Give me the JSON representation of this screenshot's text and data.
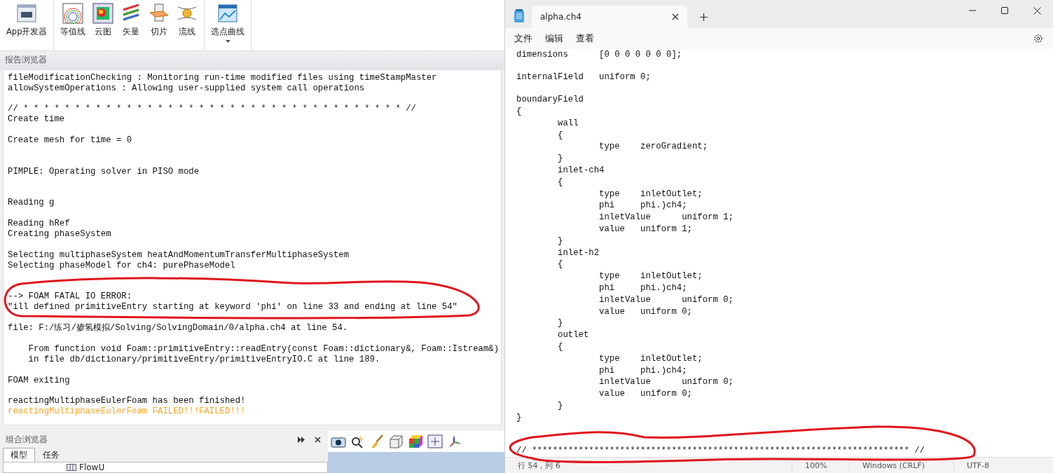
{
  "ribbon": {
    "groups": [
      {
        "buttons": [
          {
            "label": "App开发器",
            "kind": "app"
          }
        ]
      },
      {
        "buttons": [
          {
            "label": "等值线",
            "kind": "contour"
          },
          {
            "label": "云图",
            "kind": "cloud"
          },
          {
            "label": "矢量",
            "kind": "vector"
          },
          {
            "label": "切片",
            "kind": "slice"
          },
          {
            "label": "流线",
            "kind": "stream"
          }
        ]
      },
      {
        "buttons": [
          {
            "label": "选点曲线",
            "kind": "curve",
            "dropdown": true
          }
        ]
      }
    ]
  },
  "report_browser": {
    "title": "报告浏览器",
    "lines": [
      {
        "kind": "normal",
        "text": "fileModificationChecking : Monitoring run-time modified files using timeStampMaster"
      },
      {
        "kind": "normal",
        "text": "allowSystemOperations : Allowing user-supplied system call operations"
      },
      {
        "kind": "blank"
      },
      {
        "kind": "normal",
        "text": "// * * * * * * * * * * * * * * * * * * * * * * * * * * * * * * * * * * * * * //"
      },
      {
        "kind": "normal",
        "text": "Create time"
      },
      {
        "kind": "blank"
      },
      {
        "kind": "normal",
        "text": "Create mesh for time = 0"
      },
      {
        "kind": "blank"
      },
      {
        "kind": "blank"
      },
      {
        "kind": "normal",
        "text": "PIMPLE: Operating solver in PISO mode"
      },
      {
        "kind": "blank"
      },
      {
        "kind": "blank"
      },
      {
        "kind": "normal",
        "text": "Reading g"
      },
      {
        "kind": "blank"
      },
      {
        "kind": "normal",
        "text": "Reading hRef"
      },
      {
        "kind": "normal",
        "text": "Creating phaseSystem"
      },
      {
        "kind": "blank"
      },
      {
        "kind": "normal",
        "text": "Selecting multiphaseSystem heatAndMomentumTransferMultiphaseSystem"
      },
      {
        "kind": "normal",
        "text": "Selecting phaseModel for ch4: purePhaseModel"
      },
      {
        "kind": "blank"
      },
      {
        "kind": "blank"
      },
      {
        "kind": "normal",
        "text": "--> FOAM FATAL IO ERROR:"
      },
      {
        "kind": "normal",
        "text": "\"ill defined primitiveEntry starting at keyword 'phi' on line 33 and ending at line 54\""
      },
      {
        "kind": "blank"
      },
      {
        "kind": "normal",
        "text": "file: F:/练习/掺氢模拟/Solving/SolvingDomain/0/alpha.ch4 at line 54."
      },
      {
        "kind": "blank"
      },
      {
        "kind": "normal",
        "text": "    From function void Foam::primitiveEntry::readEntry(const Foam::dictionary&, Foam::Istream&)"
      },
      {
        "kind": "normal",
        "text": "    in file db/dictionary/primitiveEntry/primitiveEntryIO.C at line 189."
      },
      {
        "kind": "blank"
      },
      {
        "kind": "normal",
        "text": "FOAM exiting"
      },
      {
        "kind": "blank"
      },
      {
        "kind": "normal",
        "text": "reactingMultiphaseEulerFoam has been finished!"
      },
      {
        "kind": "error",
        "text": "reactingMultiphaseEulerFoam FAILED!!!FAILED!!!"
      }
    ]
  },
  "combo_browser": {
    "title": "组合浏览器",
    "tabs": [
      {
        "label": "模型",
        "selected": true
      },
      {
        "label": "任务",
        "selected": false
      }
    ],
    "tree_item": "FlowU"
  },
  "editor": {
    "tab_title": "alpha.ch4",
    "menu": [
      "文件",
      "编辑",
      "查看"
    ],
    "lines": [
      {
        "kind": "code",
        "text": "dimensions      [0 0 0 0 0 0 0];"
      },
      {
        "kind": "blank"
      },
      {
        "kind": "code",
        "text": "internalField   uniform 0;"
      },
      {
        "kind": "blank"
      },
      {
        "kind": "code",
        "text": "boundaryField"
      },
      {
        "kind": "code",
        "text": "{"
      },
      {
        "kind": "code",
        "text": "\twall"
      },
      {
        "kind": "code",
        "text": "\t{"
      },
      {
        "kind": "code",
        "text": "\t\ttype\tzeroGradient;"
      },
      {
        "kind": "code",
        "text": "\t}"
      },
      {
        "kind": "code",
        "text": "\tinlet-ch4"
      },
      {
        "kind": "code",
        "text": "\t{"
      },
      {
        "kind": "code",
        "text": "\t\ttype\tinletOutlet;"
      },
      {
        "kind": "code",
        "text": "\t\tphi\tphi.)ch4;"
      },
      {
        "kind": "code",
        "text": "\t\tinletValue\tuniform 1;"
      },
      {
        "kind": "code",
        "text": "\t\tvalue\tuniform 1;"
      },
      {
        "kind": "code",
        "text": "\t}"
      },
      {
        "kind": "code",
        "text": "\tinlet-h2"
      },
      {
        "kind": "code",
        "text": "\t{"
      },
      {
        "kind": "code",
        "text": "\t\ttype\tinletOutlet;"
      },
      {
        "kind": "code",
        "text": "\t\tphi\tphi.)ch4;"
      },
      {
        "kind": "code",
        "text": "\t\tinletValue\tuniform 0;"
      },
      {
        "kind": "code",
        "text": "\t\tvalue\tuniform 0;"
      },
      {
        "kind": "code",
        "text": "\t}"
      },
      {
        "kind": "code",
        "text": "\toutlet"
      },
      {
        "kind": "code",
        "text": "\t{"
      },
      {
        "kind": "code",
        "text": "\t\ttype\tinletOutlet;"
      },
      {
        "kind": "code",
        "text": "\t\tphi\tphi.)ch4;"
      },
      {
        "kind": "code",
        "text": "\t\tinletValue\tuniform 0;"
      },
      {
        "kind": "code",
        "text": "\t\tvalue\tuniform 0;"
      },
      {
        "kind": "code",
        "text": "\t}"
      },
      {
        "kind": "code",
        "text": "}"
      },
      {
        "kind": "blank"
      },
      {
        "kind": "blank"
      },
      {
        "kind": "code",
        "text": "// ************************************************************************* //"
      }
    ],
    "status_bar": {
      "position": "行 54，列 6",
      "zoom": "100%",
      "line_ending": "Windows (CRLF)",
      "encoding": "UTF-8"
    }
  }
}
